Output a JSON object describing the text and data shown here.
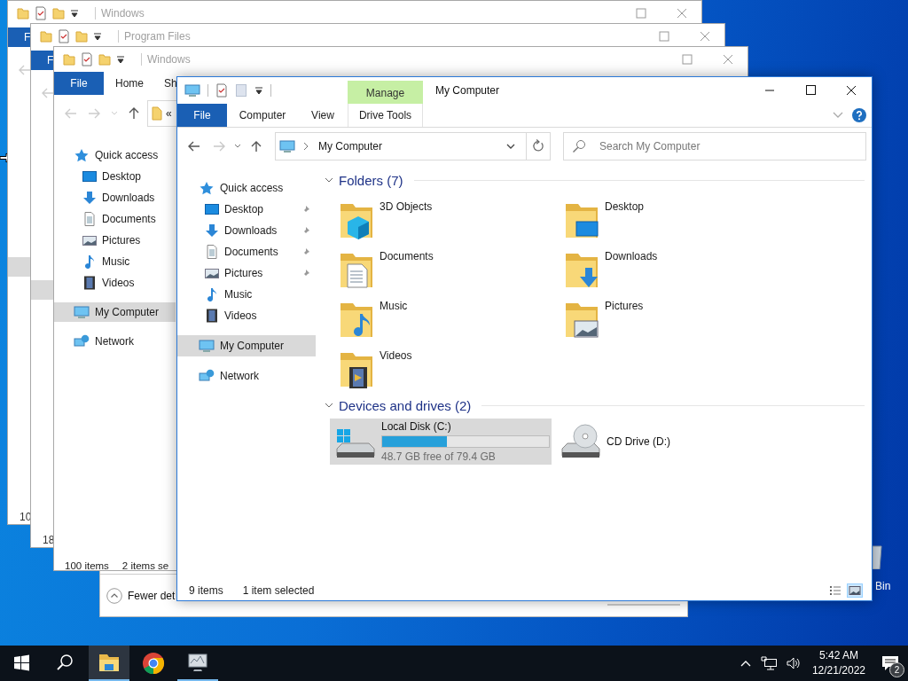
{
  "desktop": {
    "icon_label": "Bin"
  },
  "back_windows": [
    {
      "title": "Windows",
      "file_tab": "F",
      "status_count": "10"
    },
    {
      "title": "Program Files",
      "file_tab": "F",
      "status_count": "18"
    }
  ],
  "middle_window": {
    "title": "Windows",
    "tabs": [
      {
        "label": "File",
        "kind": "file"
      },
      {
        "label": "Home",
        "kind": "tab"
      },
      {
        "label": "Sh",
        "kind": "tab"
      }
    ],
    "address": "«",
    "nav": [
      {
        "label": "Quick access",
        "kind": "star",
        "selected": false,
        "children": [
          {
            "label": "Desktop",
            "kind": "desktop",
            "selected": false
          },
          {
            "label": "Downloads",
            "kind": "download",
            "selected": false
          },
          {
            "label": "Documents",
            "kind": "document",
            "selected": false
          },
          {
            "label": "Pictures",
            "kind": "picture",
            "selected": false
          },
          {
            "label": "Music",
            "kind": "music",
            "selected": false
          },
          {
            "label": "Videos",
            "kind": "video",
            "selected": false
          }
        ]
      },
      {
        "label": "My Computer",
        "kind": "computer",
        "selected": true
      },
      {
        "label": "Network",
        "kind": "network",
        "selected": false
      }
    ],
    "status": [
      "100 items",
      "2 items se"
    ]
  },
  "dialog": {
    "details_button": "Fewer det"
  },
  "explorer": {
    "title": "My Computer",
    "context_group": "Manage",
    "tabs": [
      {
        "label": "File",
        "kind": "file"
      },
      {
        "label": "Computer",
        "kind": "tab"
      },
      {
        "label": "View",
        "kind": "tab"
      },
      {
        "label": "Drive Tools",
        "kind": "context"
      }
    ],
    "nav_buttons": [
      {
        "kind": "back",
        "disabled": false
      },
      {
        "kind": "forward",
        "disabled": true
      },
      {
        "kind": "recent",
        "disabled": false
      },
      {
        "kind": "up",
        "disabled": false
      }
    ],
    "address": "My Computer",
    "search": {
      "placeholder": "Search My Computer"
    },
    "nav": [
      {
        "label": "Quick access",
        "kind": "star",
        "selected": false,
        "children": [
          {
            "label": "Desktop",
            "kind": "desktop",
            "selected": false,
            "pinned": true
          },
          {
            "label": "Downloads",
            "kind": "download",
            "selected": false,
            "pinned": true
          },
          {
            "label": "Documents",
            "kind": "document",
            "selected": false,
            "pinned": true
          },
          {
            "label": "Pictures",
            "kind": "picture",
            "selected": false,
            "pinned": true
          },
          {
            "label": "Music",
            "kind": "music",
            "selected": false,
            "pinned": false
          },
          {
            "label": "Videos",
            "kind": "video",
            "selected": false,
            "pinned": false
          }
        ]
      },
      {
        "label": "My Computer",
        "kind": "computer",
        "selected": true
      },
      {
        "label": "Network",
        "kind": "network",
        "selected": false
      }
    ],
    "groups": [
      {
        "title": "Folders (7)",
        "kind": "folders",
        "expanded": true,
        "items": [
          {
            "name": "3D Objects",
            "kind": "objects",
            "selected": false
          },
          {
            "name": "Desktop",
            "kind": "desktop",
            "selected": false
          },
          {
            "name": "Documents",
            "kind": "documents",
            "selected": false
          },
          {
            "name": "Downloads",
            "kind": "downloads",
            "selected": false
          },
          {
            "name": "Music",
            "kind": "music",
            "selected": false
          },
          {
            "name": "Pictures",
            "kind": "pictures",
            "selected": false
          },
          {
            "name": "Videos",
            "kind": "videos",
            "selected": false
          }
        ]
      },
      {
        "title": "Devices and drives (2)",
        "kind": "drives",
        "expanded": true,
        "items": [
          {
            "name": "Local Disk (C:)",
            "kind": "disk",
            "selected": true,
            "level": 0.39,
            "free": "48.7 GB free of 79.4 GB"
          },
          {
            "name": "CD Drive (D:)",
            "kind": "cd",
            "selected": false
          }
        ]
      }
    ],
    "status": {
      "count": "9 items",
      "selection": "1 item selected"
    },
    "views": [
      {
        "kind": "details",
        "selected": false
      },
      {
        "kind": "large",
        "selected": true
      }
    ]
  },
  "taskbar": {
    "apps": [
      {
        "kind": "explorer",
        "active": true,
        "running": true
      },
      {
        "kind": "chrome",
        "active": false,
        "running": false
      },
      {
        "kind": "monitor",
        "active": false,
        "running": true
      }
    ],
    "time": "5:42 AM",
    "date": "12/21/2022",
    "notifications": "2"
  }
}
